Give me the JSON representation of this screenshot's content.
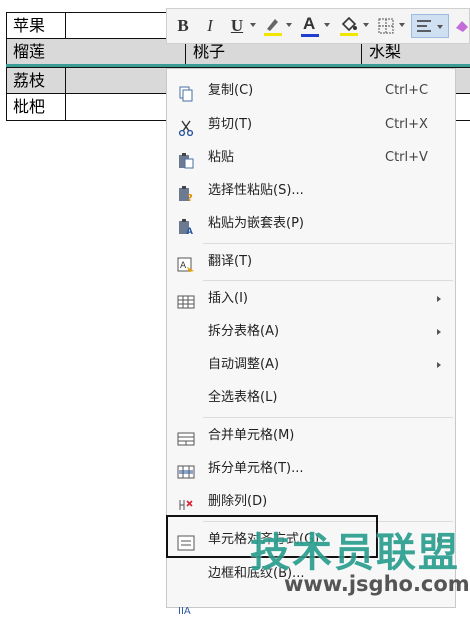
{
  "table": {
    "rows": [
      {
        "cells": [
          "苹果"
        ]
      },
      {
        "cells": [
          "榴莲",
          "桃子",
          "水梨"
        ]
      },
      {
        "cells": [
          "荔枝"
        ]
      },
      {
        "cells": [
          "枇杷"
        ]
      }
    ]
  },
  "toolbar": {
    "bold": "B",
    "italic": "I",
    "underline": "U",
    "font_color": "A",
    "icons": [
      "bold-icon",
      "italic-icon",
      "underline-icon",
      "highlight-icon",
      "font-color-icon",
      "fill-color-icon",
      "border-icon",
      "align-icon",
      "eraser-icon"
    ]
  },
  "menu": {
    "items": [
      {
        "label": "复制(C)",
        "shortcut": "Ctrl+C",
        "icon": "copy-icon"
      },
      {
        "label": "剪切(T)",
        "shortcut": "Ctrl+X",
        "icon": "scissors-icon"
      },
      {
        "label": "粘贴",
        "shortcut": "Ctrl+V",
        "icon": "paste-icon"
      },
      {
        "label": "选择性粘贴(S)...",
        "icon": "paste-special-icon"
      },
      {
        "label": "粘贴为嵌套表(P)",
        "icon": "paste-nested-table-icon"
      },
      {
        "label": "翻译(T)",
        "icon": "translate-icon"
      },
      {
        "label": "插入(I)",
        "icon": "table-insert-icon"
      },
      {
        "label": "拆分表格(A)"
      },
      {
        "label": "自动调整(A)"
      },
      {
        "label": "全选表格(L)"
      },
      {
        "label": "合并单元格(M)",
        "icon": "merge-cells-icon"
      },
      {
        "label": "拆分单元格(T)...",
        "icon": "split-cells-icon"
      },
      {
        "label": "删除列(D)",
        "icon": "delete-column-icon"
      },
      {
        "label": "单元格对齐方式(G)",
        "icon": "cell-align-icon"
      },
      {
        "label": "边框和底纹(B)..."
      }
    ]
  },
  "watermark": {
    "text": "技术员联盟",
    "url": "www.jsgho.com"
  },
  "colors": {
    "accent": "#3b9c94",
    "watermark": "#2b9e8f",
    "row_fill": "#d9d9d9"
  }
}
